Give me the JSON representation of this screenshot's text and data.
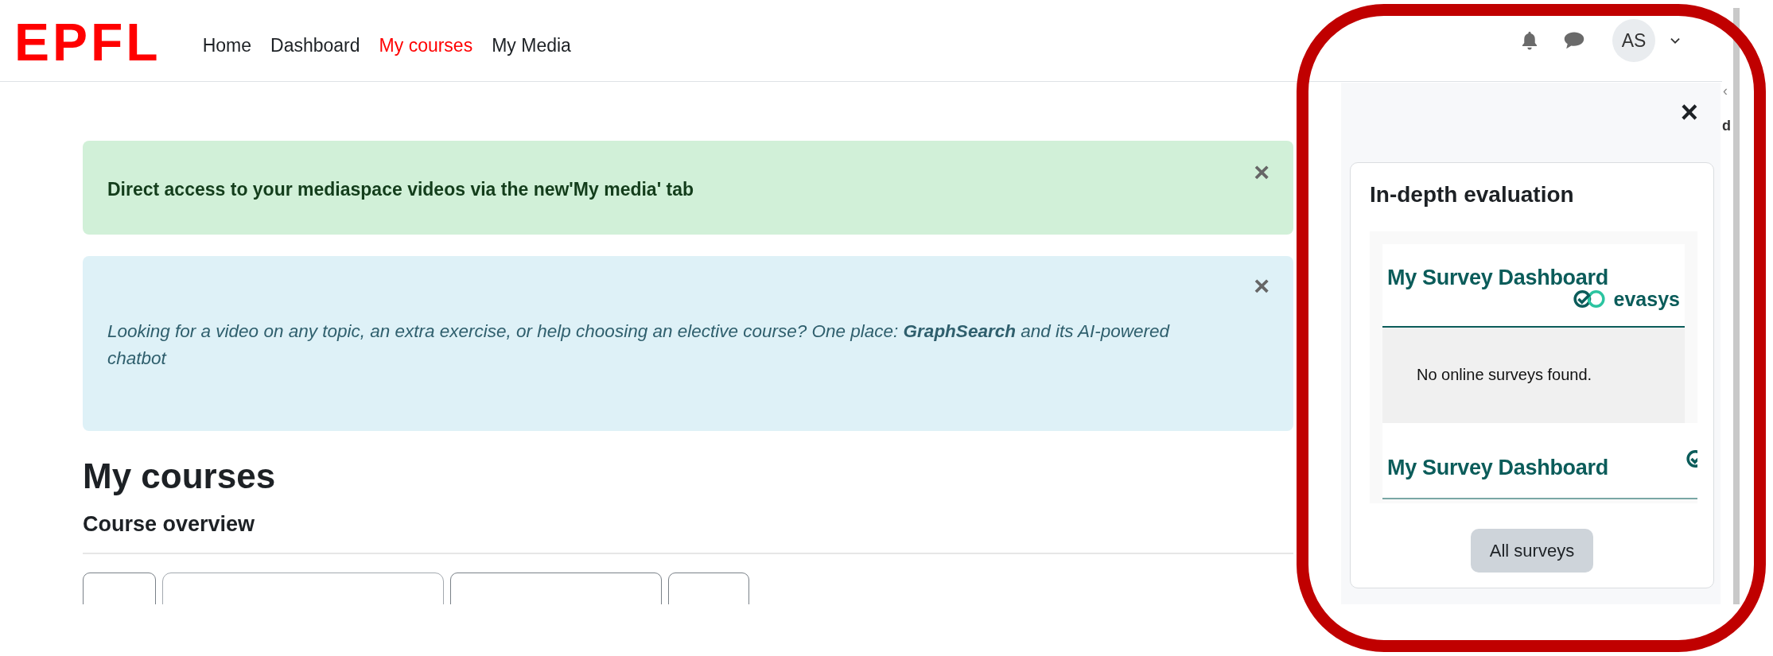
{
  "header": {
    "logo": "EPFL",
    "nav": [
      {
        "label": "Home",
        "selected": false
      },
      {
        "label": "Dashboard",
        "selected": false
      },
      {
        "label": "My courses",
        "selected": true
      },
      {
        "label": "My Media",
        "selected": false
      }
    ],
    "avatar": "AS"
  },
  "alerts": [
    {
      "kind": "success",
      "text": "Direct access to your mediaspace videos via the new'My media' tab",
      "close": "×"
    },
    {
      "kind": "info",
      "text": "Looking for a video on any topic, an extra exercise, or help choosing an elective course? One place: **GraphSearch** and its AI-powered chatbot",
      "close": "×"
    }
  ],
  "page_title": "My courses",
  "section_title": "Course overview",
  "filter_controls": [
    {
      "kind": "dropdown"
    },
    {
      "kind": "search"
    },
    {
      "kind": "dropdown"
    },
    {
      "kind": "dropdown"
    }
  ],
  "behind_panel": {
    "chevron": "‹",
    "letter": "d"
  },
  "drawer": {
    "close": "×",
    "block_title": "In-depth evaluation",
    "surveys": [
      {
        "title": "My Survey Dashboard",
        "logo_text": "evasys",
        "message": "No online surveys found."
      },
      {
        "title": "My Survey Dashboard"
      }
    ],
    "button": "All surveys"
  }
}
